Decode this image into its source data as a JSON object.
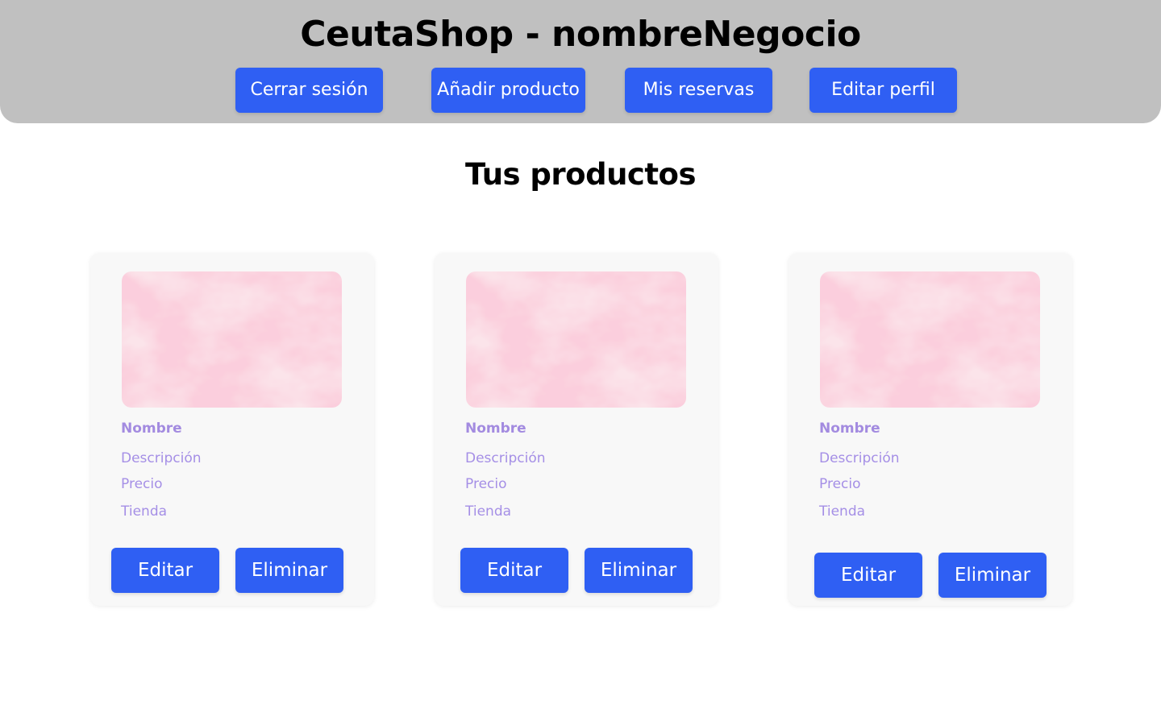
{
  "header": {
    "title": "CeutaShop - nombreNegocio",
    "nav": [
      {
        "label": "Cerrar sesión"
      },
      {
        "label": "Añadir producto"
      },
      {
        "label": "Mis reservas"
      },
      {
        "label": "Editar perfil"
      }
    ]
  },
  "main": {
    "section_title": "Tus productos",
    "products": [
      {
        "name": "Nombre",
        "description": "Descripción",
        "price": "Precio",
        "shop": "Tienda",
        "edit_label": "Editar",
        "delete_label": "Eliminar"
      },
      {
        "name": "Nombre",
        "description": "Descripción",
        "price": "Precio",
        "shop": "Tienda",
        "edit_label": "Editar",
        "delete_label": "Eliminar"
      },
      {
        "name": "Nombre",
        "description": "Descripción",
        "price": "Precio",
        "shop": "Tienda",
        "edit_label": "Editar",
        "delete_label": "Eliminar"
      }
    ]
  },
  "colors": {
    "header_bg": "#c0c0c0",
    "button_bg": "#2f5ff3",
    "label_text": "#a58fe6",
    "card_bg": "#f8f8f8"
  }
}
